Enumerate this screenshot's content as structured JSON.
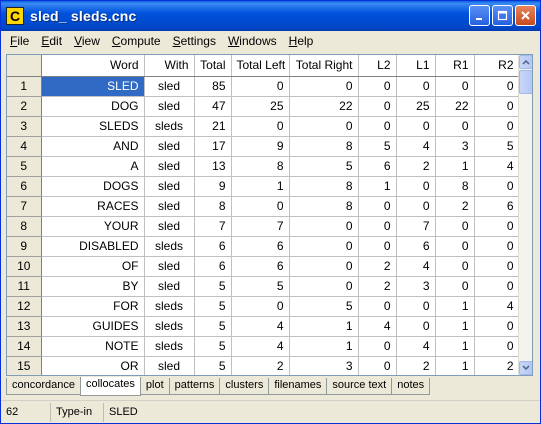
{
  "window": {
    "title": "sled_ sleds.cnc",
    "app_icon_letter": "C"
  },
  "menu": [
    "File",
    "Edit",
    "View",
    "Compute",
    "Settings",
    "Windows",
    "Help"
  ],
  "menu_underline": [
    "F",
    "E",
    "V",
    "C",
    "S",
    "W",
    "H"
  ],
  "columns": [
    "Word",
    "With",
    "Total",
    "Total Left",
    "Total Right",
    "L2",
    "L1",
    "R1",
    "R2"
  ],
  "rows": [
    {
      "n": "1",
      "word": "SLED",
      "with": "sled",
      "vals": [
        "85",
        "0",
        "0",
        "0",
        "0",
        "0",
        "0"
      ]
    },
    {
      "n": "2",
      "word": "DOG",
      "with": "sled",
      "vals": [
        "47",
        "25",
        "22",
        "0",
        "25",
        "22",
        "0"
      ]
    },
    {
      "n": "3",
      "word": "SLEDS",
      "with": "sleds",
      "vals": [
        "21",
        "0",
        "0",
        "0",
        "0",
        "0",
        "0"
      ]
    },
    {
      "n": "4",
      "word": "AND",
      "with": "sled",
      "vals": [
        "17",
        "9",
        "8",
        "5",
        "4",
        "3",
        "5"
      ]
    },
    {
      "n": "5",
      "word": "A",
      "with": "sled",
      "vals": [
        "13",
        "8",
        "5",
        "6",
        "2",
        "1",
        "4"
      ]
    },
    {
      "n": "6",
      "word": "DOGS",
      "with": "sled",
      "vals": [
        "9",
        "1",
        "8",
        "1",
        "0",
        "8",
        "0"
      ]
    },
    {
      "n": "7",
      "word": "RACES",
      "with": "sled",
      "vals": [
        "8",
        "0",
        "8",
        "0",
        "0",
        "2",
        "6"
      ]
    },
    {
      "n": "8",
      "word": "YOUR",
      "with": "sled",
      "vals": [
        "7",
        "7",
        "0",
        "0",
        "7",
        "0",
        "0"
      ]
    },
    {
      "n": "9",
      "word": "DISABLED",
      "with": "sleds",
      "vals": [
        "6",
        "6",
        "0",
        "0",
        "6",
        "0",
        "0"
      ]
    },
    {
      "n": "10",
      "word": "OF",
      "with": "sled",
      "vals": [
        "6",
        "6",
        "0",
        "2",
        "4",
        "0",
        "0"
      ]
    },
    {
      "n": "11",
      "word": "BY",
      "with": "sled",
      "vals": [
        "5",
        "5",
        "0",
        "2",
        "3",
        "0",
        "0"
      ]
    },
    {
      "n": "12",
      "word": "FOR",
      "with": "sleds",
      "vals": [
        "5",
        "0",
        "5",
        "0",
        "0",
        "1",
        "4"
      ]
    },
    {
      "n": "13",
      "word": "GUIDES",
      "with": "sleds",
      "vals": [
        "5",
        "4",
        "1",
        "4",
        "0",
        "1",
        "0"
      ]
    },
    {
      "n": "14",
      "word": "NOTE",
      "with": "sleds",
      "vals": [
        "5",
        "4",
        "1",
        "0",
        "4",
        "1",
        "0"
      ]
    },
    {
      "n": "15",
      "word": "OR",
      "with": "sled",
      "vals": [
        "5",
        "2",
        "3",
        "0",
        "2",
        "1",
        "2"
      ]
    }
  ],
  "selected_row": 0,
  "tabs": [
    "concordance",
    "collocates",
    "plot",
    "patterns",
    "clusters",
    "filenames",
    "source text",
    "notes"
  ],
  "active_tab": "collocates",
  "status": {
    "count": "62",
    "mode": "Type-in",
    "word": "SLED"
  },
  "colors": {
    "title_bar": "#0052dc",
    "selection": "#316ac5",
    "close_button": "#c64a1e"
  },
  "icons": [
    "minimize-icon",
    "maximize-icon",
    "close-icon",
    "scroll-up-icon",
    "scroll-down-icon"
  ]
}
